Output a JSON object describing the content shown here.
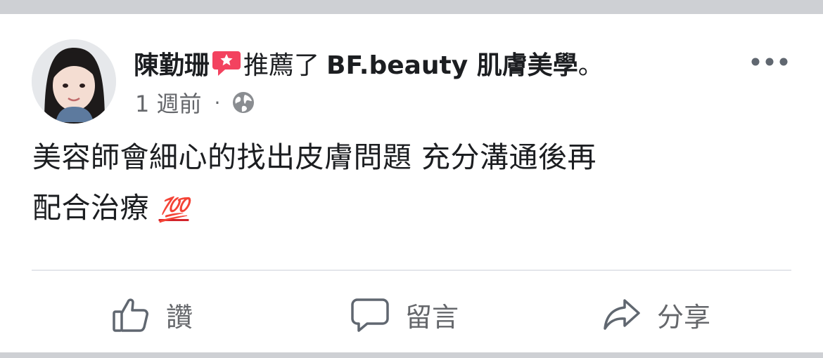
{
  "post": {
    "author": "陳勤珊",
    "action_text": "推薦了",
    "page_name": "BF.beauty 肌膚美學",
    "end_punct": "。",
    "time": "1 週前",
    "separator": "·",
    "audience_icon": "globe-icon",
    "text_line1": "美容師會細心的找出皮膚問題 充分溝通後再",
    "text_line2": "配合治療",
    "emoji": "💯"
  },
  "actions": {
    "like_label": "讚",
    "comment_label": "留言",
    "share_label": "分享"
  },
  "colors": {
    "background": "#ffffff",
    "band": "#ced0d4",
    "text": "#1c1e21",
    "secondary": "#65676b",
    "recommend": "#f3425f"
  }
}
